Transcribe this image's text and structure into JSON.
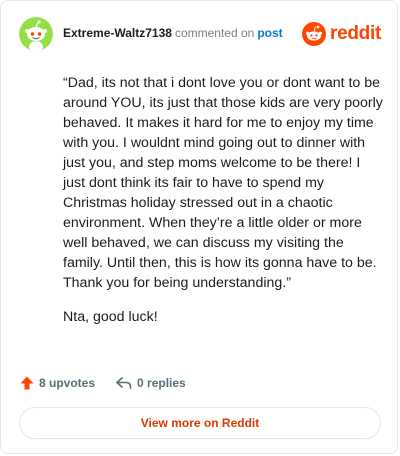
{
  "header": {
    "username": "Extreme-Waltz7138",
    "action_text": "commented on",
    "post_link": "post",
    "brand": "reddit"
  },
  "comment": {
    "paragraphs": [
      "“Dad, its not that i dont love you or dont want to be around YOU, its just that those kids are very poorly behaved. It makes it hard for me to enjoy my time with you. I wouldnt mind going out to dinner with just you, and step moms welcome to be there! I just dont think its fair to have to spend my Christmas holiday stressed out in a chaotic environment. When they’re a little older or more well behaved, we can discuss my visiting the family. Until then, this is how its gonna have to be. Thank you for being understanding.”",
      "Nta, good luck!"
    ]
  },
  "actions": {
    "upvotes": "8 upvotes",
    "replies": "0 replies"
  },
  "footer": {
    "view_more": "View more on Reddit"
  },
  "colors": {
    "brand": "#ff4500",
    "link": "#0079d3",
    "avatar_bg": "#94e044"
  },
  "icons": {
    "avatar": "snoo-avatar-icon",
    "brand_logo": "reddit-logo-icon",
    "upvote": "upvote-arrow-icon",
    "reply": "reply-arrow-icon"
  }
}
